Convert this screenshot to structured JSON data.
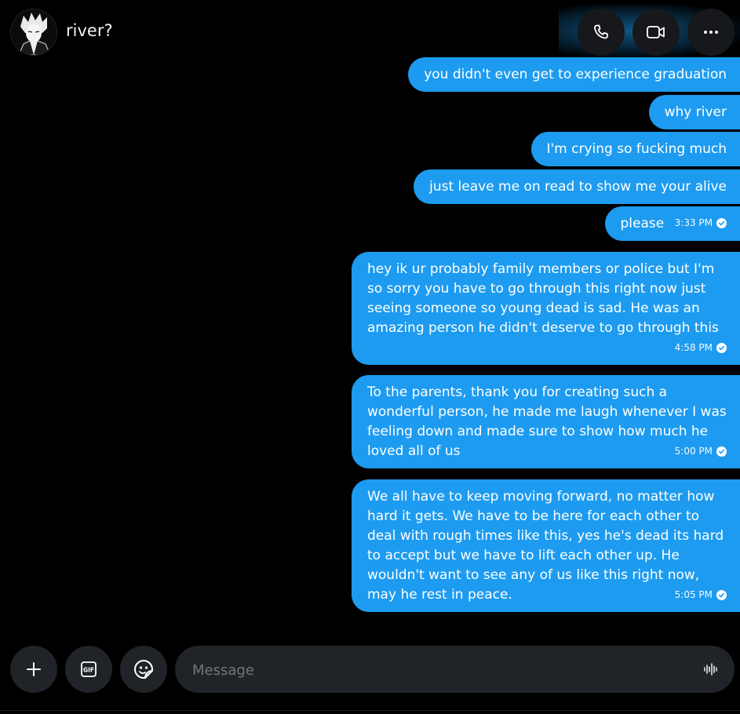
{
  "header": {
    "contact_name": "river?",
    "actions": [
      {
        "name": "phone-icon",
        "label": "call"
      },
      {
        "name": "video-icon",
        "label": "video"
      },
      {
        "name": "more-icon",
        "label": "more"
      }
    ]
  },
  "messages": [
    {
      "text": "you didn't even get to experience graduation"
    },
    {
      "text": "why river"
    },
    {
      "text": "I'm crying so fucking much"
    },
    {
      "text": "just leave me on read to show me your alive"
    },
    {
      "text": "please",
      "time": "3:33 PM"
    },
    {
      "text": "hey ik ur probably family members or police but I'm so sorry you have to go through this right now just seeing someone so young dead is sad. He was an amazing person he didn't deserve to go through this",
      "time": "4:58 PM"
    },
    {
      "text": "To the parents, thank you for creating such a wonderful person, he made me laugh whenever I was feeling down and made sure to show how much he loved all of us",
      "time": "5:00 PM"
    },
    {
      "text": "We all have to keep moving forward, no matter how hard it gets. We have to be here for each other to deal with rough times like this, yes he's dead its hard to accept but we have to lift each other up. He wouldn't want to see any of us like this right now, may he rest in peace.",
      "time": "5:05 PM"
    }
  ],
  "composer": {
    "placeholder": "Message",
    "gif_label": "GIF"
  },
  "colors": {
    "bubble": "#1d9bf0",
    "background": "#000000",
    "control": "#202327"
  }
}
